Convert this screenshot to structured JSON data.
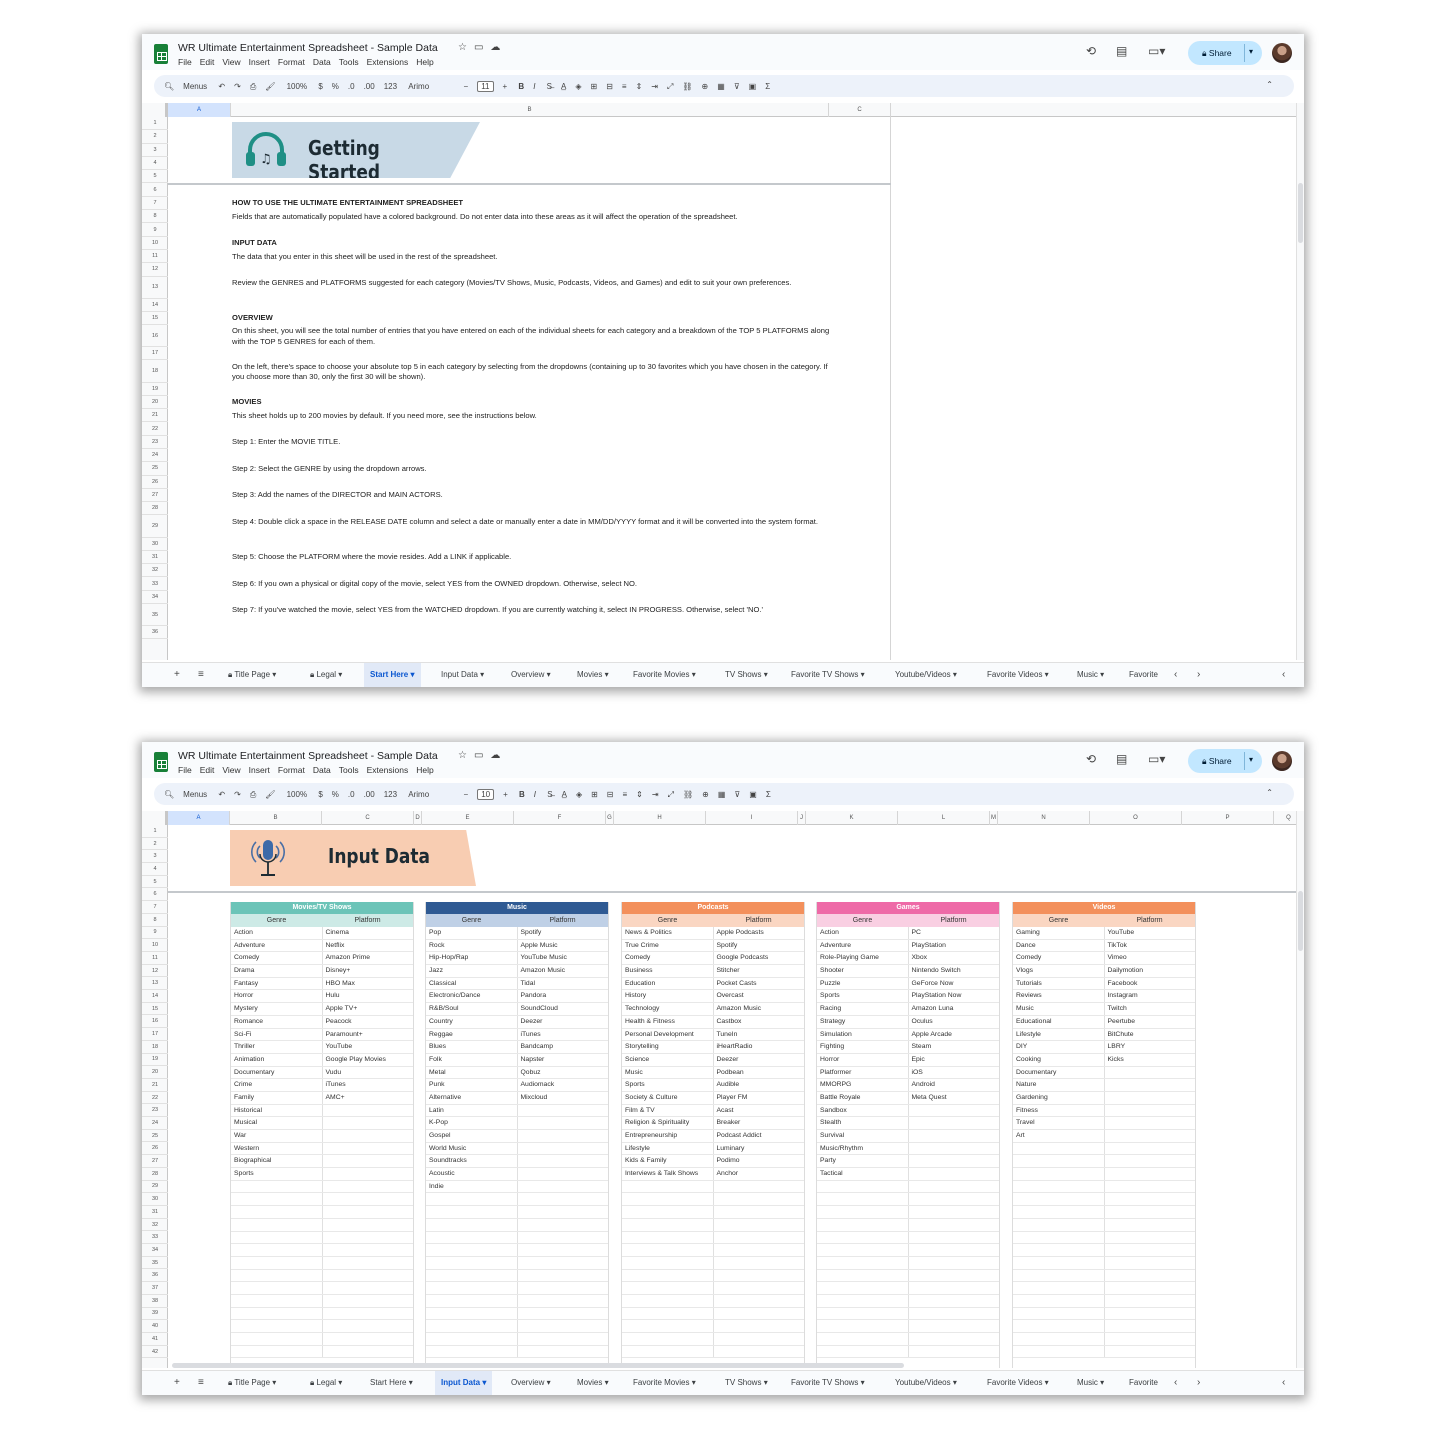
{
  "app": {
    "title": "WR Ultimate Entertainment Spreadsheet - Sample Data",
    "menus": [
      "File",
      "Edit",
      "View",
      "Insert",
      "Format",
      "Data",
      "Tools",
      "Extensions",
      "Help"
    ],
    "share_label": "Share"
  },
  "toolbar": {
    "menus_label": "Menus",
    "zoom": "100%",
    "currency": "$",
    "percent": "%",
    "dec_less": ".0",
    "dec_more": ".00",
    "number_format": "123",
    "font": "Arimo",
    "minus": "−",
    "plus": "+",
    "bold": "B",
    "italic": "I"
  },
  "sheet1": {
    "font_size": "11",
    "columns": [
      "A",
      "B",
      "C"
    ],
    "banner_title": "Getting Started",
    "lines": [
      {
        "row": 7,
        "style": "h",
        "text": "HOW TO USE THE ULTIMATE ENTERTAINMENT SPREADSHEET"
      },
      {
        "row": 8,
        "style": "n",
        "text": "Fields that are automatically populated have a colored background. Do not enter data into these areas as it will affect the operation of the spreadsheet."
      },
      {
        "row": 10,
        "style": "h",
        "text": "INPUT DATA"
      },
      {
        "row": 11,
        "style": "n",
        "text": "The data that you enter in this sheet will be used in the rest of the spreadsheet."
      },
      {
        "row": 13,
        "style": "n",
        "text": "Review the GENRES and PLATFORMS suggested for each category (Movies/TV Shows, Music, Podcasts, Videos, and Games) and edit to suit your own preferences."
      },
      {
        "row": 15,
        "style": "h",
        "text": "OVERVIEW"
      },
      {
        "row": 16,
        "style": "n",
        "text": "On this sheet, you will see the total number of entries that you have entered on each of the individual sheets for each category and a breakdown of the TOP 5 PLATFORMS along with the TOP 5 GENRES for each of them."
      },
      {
        "row": 18,
        "style": "n",
        "text": "On the left, there's space to choose your absolute top 5 in each category by selecting from the dropdowns (containing up to 30 favorites which you have chosen in the category. If you choose more than 30, only the first 30 will be shown)."
      },
      {
        "row": 20,
        "style": "h",
        "text": "MOVIES"
      },
      {
        "row": 21,
        "style": "n",
        "text": "This sheet holds up to 200 movies by default. If you need more, see the instructions below."
      },
      {
        "row": 23,
        "style": "n",
        "text": "Step 1: Enter the MOVIE TITLE."
      },
      {
        "row": 25,
        "style": "n",
        "text": "Step 2: Select the GENRE by using the dropdown arrows."
      },
      {
        "row": 27,
        "style": "n",
        "text": "Step 3: Add the names of the DIRECTOR and MAIN ACTORS."
      },
      {
        "row": 29,
        "style": "n",
        "text": "Step 4: Double click a space in the RELEASE DATE column and select a date or manually enter a date in MM/DD/YYYY format and it will be converted into the system format."
      },
      {
        "row": 31,
        "style": "n",
        "text": "Step 5: Choose the PLATFORM where the movie resides. Add a LINK if applicable."
      },
      {
        "row": 33,
        "style": "n",
        "text": "Step 6: If you own a physical or digital copy of the movie, select YES from the OWNED dropdown. Otherwise, select NO."
      },
      {
        "row": 35,
        "style": "n",
        "text": "Step 7: If you've watched the movie, select YES from the WATCHED dropdown. If you are currently watching it, select IN PROGRESS. Otherwise, select 'NO.'"
      }
    ]
  },
  "sheet2": {
    "font_size": "10",
    "columns": [
      "A",
      "B",
      "C",
      "D",
      "E",
      "F",
      "G",
      "H",
      "I",
      "J",
      "K",
      "L",
      "M",
      "N",
      "O",
      "P",
      "Q"
    ],
    "banner_title": "Input Data",
    "tables": [
      {
        "title": "Movies/TV Shows",
        "color": "#6cc4b8",
        "sub_color": "#cdeae6",
        "genre_label": "Genre",
        "platform_label": "Platform",
        "genres": [
          "Action",
          "Adventure",
          "Comedy",
          "Drama",
          "Fantasy",
          "Horror",
          "Mystery",
          "Romance",
          "Sci-Fi",
          "Thriller",
          "Animation",
          "Documentary",
          "Crime",
          "Family",
          "Historical",
          "Musical",
          "War",
          "Western",
          "Biographical",
          "Sports"
        ],
        "platforms": [
          "Cinema",
          "Netflix",
          "Amazon Prime",
          "Disney+",
          "HBO Max",
          "Hulu",
          "Apple TV+",
          "Peacock",
          "Paramount+",
          "YouTube",
          "Google Play Movies",
          "Vudu",
          "iTunes",
          "AMC+"
        ]
      },
      {
        "title": "Music",
        "color": "#2f5a93",
        "sub_color": "#bfd0e6",
        "genre_label": "Genre",
        "platform_label": "Platform",
        "genres": [
          "Pop",
          "Rock",
          "Hip-Hop/Rap",
          "Jazz",
          "Classical",
          "Electronic/Dance",
          "R&B/Soul",
          "Country",
          "Reggae",
          "Blues",
          "Folk",
          "Metal",
          "Punk",
          "Alternative",
          "Latin",
          "K-Pop",
          "Gospel",
          "World Music",
          "Soundtracks",
          "Acoustic",
          "Indie"
        ],
        "platforms": [
          "Spotify",
          "Apple Music",
          "YouTube Music",
          "Amazon Music",
          "Tidal",
          "Pandora",
          "SoundCloud",
          "Deezer",
          "iTunes",
          "Bandcamp",
          "Napster",
          "Qobuz",
          "Audiomack",
          "Mixcloud"
        ]
      },
      {
        "title": "Podcasts",
        "color": "#f3905c",
        "sub_color": "#fad6c2",
        "genre_label": "Genre",
        "platform_label": "Platform",
        "genres": [
          "News & Politics",
          "True Crime",
          "Comedy",
          "Business",
          "Education",
          "History",
          "Technology",
          "Health & Fitness",
          "Personal Development",
          "Storytelling",
          "Science",
          "Music",
          "Sports",
          "Society & Culture",
          "Film & TV",
          "Religion & Spirituality",
          "Entrepreneurship",
          "Lifestyle",
          "Kids & Family",
          "Interviews & Talk Shows"
        ],
        "platforms": [
          "Apple Podcasts",
          "Spotify",
          "Google Podcasts",
          "Stitcher",
          "Pocket Casts",
          "Overcast",
          "Amazon Music",
          "Castbox",
          "TuneIn",
          "iHeartRadio",
          "Deezer",
          "Podbean",
          "Audible",
          "Player FM",
          "Acast",
          "Breaker",
          "Podcast Addict",
          "Luminary",
          "Podimo",
          "Anchor"
        ]
      },
      {
        "title": "Games",
        "color": "#ee6aa7",
        "sub_color": "#f9cfe2",
        "genre_label": "Genre",
        "platform_label": "Platform",
        "genres": [
          "Action",
          "Adventure",
          "Role-Playing Game",
          "Shooter",
          "Puzzle",
          "Sports",
          "Racing",
          "Strategy",
          "Simulation",
          "Fighting",
          "Horror",
          "Platformer",
          "MMORPG",
          "Battle Royale",
          "Sandbox",
          "Stealth",
          "Survival",
          "Music/Rhythm",
          "Party",
          "Tactical"
        ],
        "platforms": [
          "PC",
          "PlayStation",
          "Xbox",
          "Nintendo Switch",
          "GeForce Now",
          "PlayStation Now",
          "Amazon Luna",
          "Oculus",
          "Apple Arcade",
          "Steam",
          "Epic",
          "iOS",
          "Android",
          "Meta Quest"
        ]
      },
      {
        "title": "Videos",
        "color": "#f3905c",
        "sub_color": "#fad6c2",
        "genre_label": "Genre",
        "platform_label": "Platform",
        "genres": [
          "Gaming",
          "Dance",
          "Comedy",
          "Vlogs",
          "Tutorials",
          "Reviews",
          "Music",
          "Educational",
          "Lifestyle",
          "DIY",
          "Cooking",
          "Documentary",
          "Nature",
          "Gardening",
          "Fitness",
          "Travel",
          "Art"
        ],
        "platforms": [
          "YouTube",
          "TikTok",
          "Vimeo",
          "Dailymotion",
          "Facebook",
          "Instagram",
          "Twitch",
          "Peertube",
          "BitChute",
          "LBRY",
          "Kicks"
        ]
      }
    ]
  },
  "tabs": [
    "Title Page",
    "Legal",
    "Start Here",
    "Input Data",
    "Overview",
    "Movies",
    "Favorite Movies",
    "TV Shows",
    "Favorite TV Shows",
    "Youtube/Videos",
    "Favorite Videos",
    "Music",
    "Favorite"
  ],
  "active_tab_1": "Start Here",
  "active_tab_2": "Input Data"
}
